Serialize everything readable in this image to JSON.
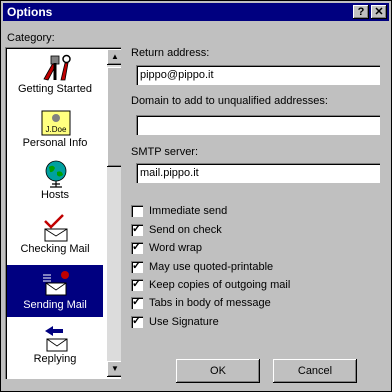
{
  "window": {
    "title": "Options",
    "help_glyph": "?",
    "close_glyph": "✕"
  },
  "category_label": "Category:",
  "categories": [
    {
      "label": "Getting Started",
      "icon": "tools-icon"
    },
    {
      "label": "Personal Info",
      "icon": "id-card-icon",
      "icon_text": "J.Doe"
    },
    {
      "label": "Hosts",
      "icon": "globe-icon"
    },
    {
      "label": "Checking Mail",
      "icon": "mail-check-icon"
    },
    {
      "label": "Sending Mail",
      "icon": "mail-send-icon",
      "selected": true
    },
    {
      "label": "Replying",
      "icon": "reply-icon"
    }
  ],
  "fields": {
    "return_address": {
      "label": "Return address:",
      "value": "pippo@pippo.it"
    },
    "domain": {
      "label": "Domain to add to unqualified addresses:",
      "value": ""
    },
    "smtp": {
      "label": "SMTP server:",
      "value": "mail.pippo.it"
    }
  },
  "options": [
    {
      "label": "Immediate send",
      "checked": false
    },
    {
      "label": "Send on check",
      "checked": true
    },
    {
      "label": "Word wrap",
      "checked": true
    },
    {
      "label": "May use quoted-printable",
      "checked": true
    },
    {
      "label": "Keep copies of outgoing mail",
      "checked": true
    },
    {
      "label": "Tabs in body of message",
      "checked": true
    },
    {
      "label": "Use Signature",
      "checked": true
    }
  ],
  "checkmark": "✓",
  "buttons": {
    "ok": "OK",
    "cancel": "Cancel"
  }
}
